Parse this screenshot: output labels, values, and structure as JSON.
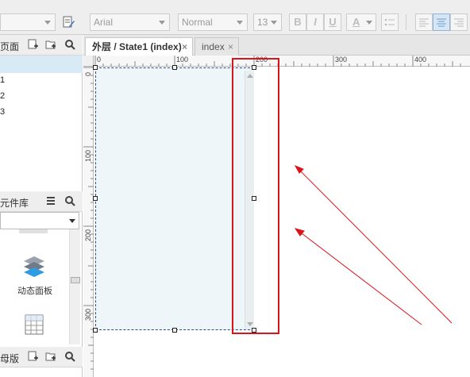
{
  "toolbar": {
    "font_family": "Arial",
    "font_style": "Normal",
    "font_size": "13",
    "bold_label": "B",
    "italic_label": "I",
    "underline_label": "U",
    "font_color_label": "A"
  },
  "pages_panel": {
    "title": "页面",
    "items": [
      "1",
      "2",
      "3"
    ]
  },
  "widget_library": {
    "title": "元件库",
    "widgets": [
      {
        "label": "动态面板",
        "icon": "dynamic-panel-icon"
      },
      {
        "label": "",
        "icon": "table-icon"
      }
    ]
  },
  "masters_panel": {
    "title": "母版"
  },
  "tabs": [
    {
      "label": "外层 / State1 (index)",
      "active": true
    },
    {
      "label": "index",
      "active": false
    }
  ],
  "tab_close_glyph": "×",
  "ruler": {
    "h_labels": [
      "0",
      "100",
      "200",
      "300",
      "400"
    ],
    "v_labels": [
      "0",
      "100",
      "200",
      "300"
    ]
  },
  "colors": {
    "accent_red": "#d9141a",
    "selection_dash": "#2b4f8e",
    "panel_fill": "#eef6fa",
    "selected_row": "#d9eaf7"
  }
}
